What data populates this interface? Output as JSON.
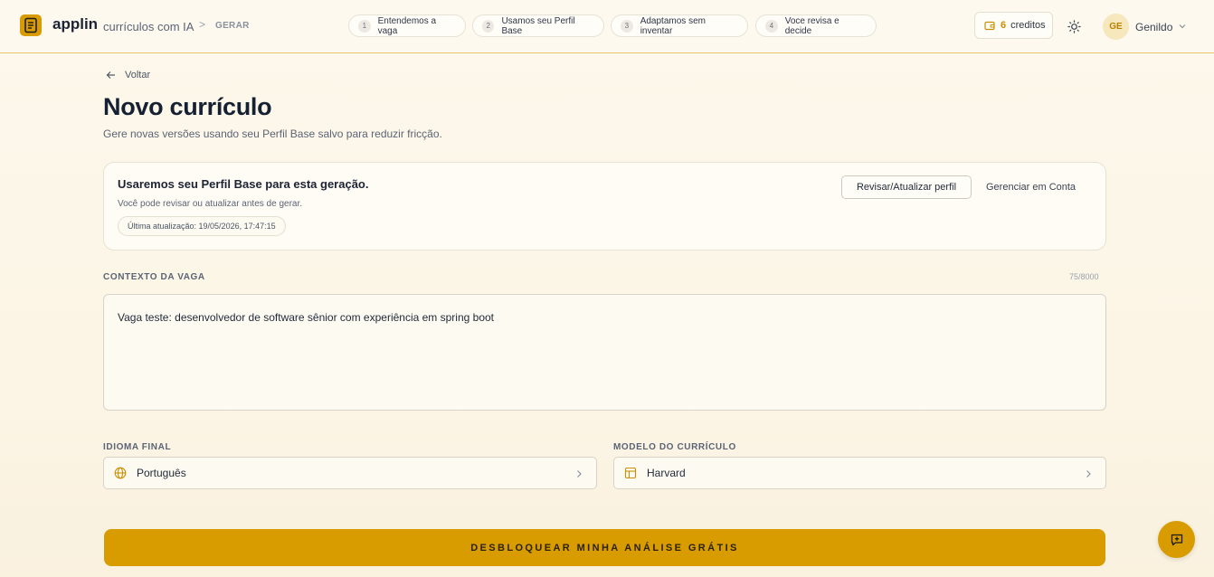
{
  "header": {
    "brand": "applin",
    "brand_sub": "currículos com IA",
    "breadcrumb_sep": ">",
    "breadcrumb": "GERAR",
    "steps": [
      {
        "num": "1",
        "label": "Entendemos a vaga"
      },
      {
        "num": "2",
        "label": "Usamos seu Perfil Base"
      },
      {
        "num": "3",
        "label": "Adaptamos sem inventar"
      },
      {
        "num": "4",
        "label": "Voce revisa e decide"
      }
    ],
    "credits_count": "6",
    "credits_label": "creditos",
    "avatar_initials": "GE",
    "username": "Genildo"
  },
  "main": {
    "back_label": "Voltar",
    "title": "Novo currículo",
    "subtitle": "Gere novas versões usando seu Perfil Base salvo para reduzir fricção."
  },
  "profile_card": {
    "title": "Usaremos seu Perfil Base para esta geração.",
    "description": "Você pode revisar ou atualizar antes de gerar.",
    "last_updated": "Última atualização: 19/05/2026, 17:47:15",
    "review_button": "Revisar/Atualizar perfil",
    "manage_link": "Gerenciar em Conta"
  },
  "context": {
    "label": "CONTEXTO DA VAGA",
    "counter": "75/8000",
    "value": "Vaga teste: desenvolvedor de software sênior com experiência em spring boot"
  },
  "language": {
    "label": "IDIOMA FINAL",
    "value": "Português"
  },
  "template": {
    "label": "MODELO DO CURRÍCULO",
    "value": "Harvard"
  },
  "cta_label": "DESBLOQUEAR MINHA ANÁLISE GRÁTIS",
  "colors": {
    "accent": "#d89c00",
    "header_border": "#e8c66b",
    "background": "#fdf8ec"
  },
  "icons": {
    "logo": "document-icon",
    "credits": "wallet-icon",
    "theme": "sun-icon",
    "back": "arrow-left-icon",
    "language": "globe-icon",
    "template": "layout-icon",
    "fab": "message-plus-icon"
  }
}
